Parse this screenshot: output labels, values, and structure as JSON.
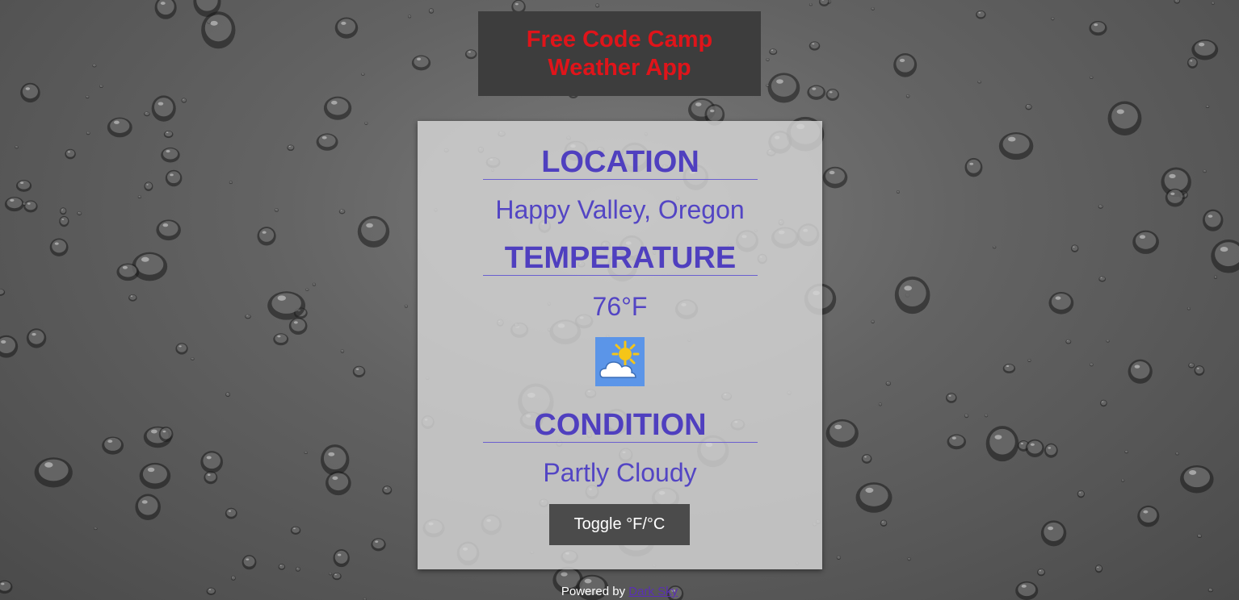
{
  "header": {
    "title_line1": "Free Code Camp",
    "title_line2": "Weather App"
  },
  "card": {
    "location_heading": "LOCATION",
    "location_value": "Happy Valley, Oregon",
    "temperature_heading": "TEMPERATURE",
    "temperature_value": "76°F",
    "weather_icon": "partly-cloudy-day-icon",
    "condition_heading": "CONDITION",
    "condition_value": "Partly Cloudy",
    "toggle_label": "Toggle °F/°C"
  },
  "footer": {
    "powered_by": "Powered by",
    "link_text": "Dark Sky"
  },
  "colors": {
    "title": "#e0141a",
    "accent": "#5345c4",
    "button_bg": "#4b4b4b",
    "icon_bg": "#5b95e8",
    "sun": "#f5c518"
  }
}
